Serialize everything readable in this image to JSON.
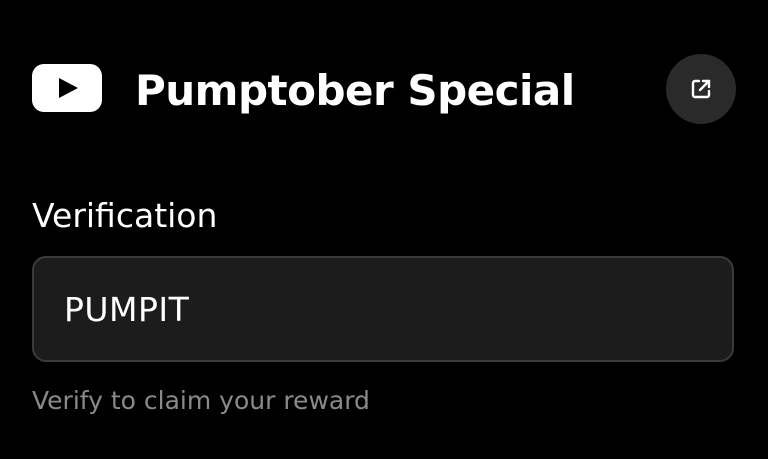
{
  "header": {
    "logo_icon": "youtube-logo-icon",
    "title": "Pumptober Special",
    "external_link_icon": "external-link-icon"
  },
  "verification": {
    "label": "Verification",
    "value": "PUMPIT",
    "hint": "Verify to claim your reward"
  },
  "colors": {
    "background": "#000000",
    "text": "#ffffff",
    "button_bg": "#2a2a2a",
    "input_bg": "#1c1c1c",
    "input_border": "#3a3a3a",
    "hint_text": "#8a8a8a"
  }
}
